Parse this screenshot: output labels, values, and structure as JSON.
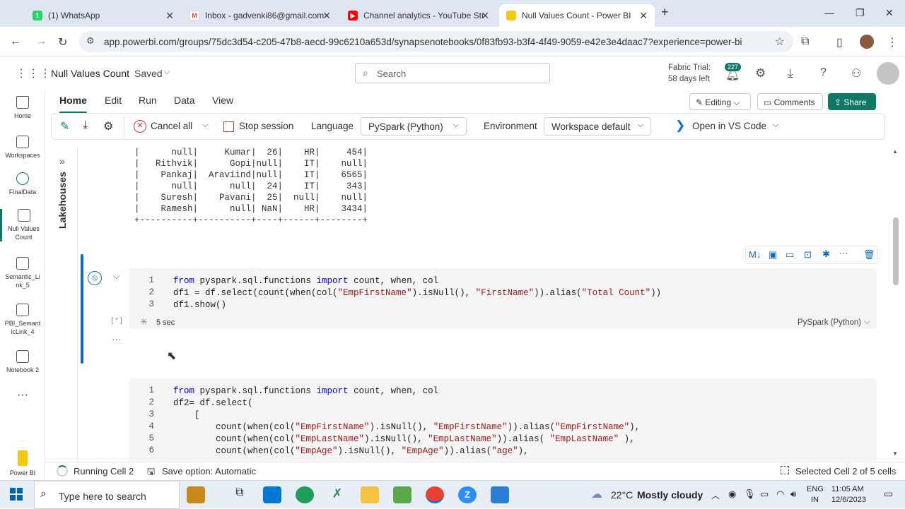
{
  "browser": {
    "tabs": [
      {
        "label": "(1) WhatsApp",
        "icon": "whatsapp-icon",
        "color": "#25d366"
      },
      {
        "label": "Inbox - gadvenki86@gmail.com",
        "icon": "gmail-icon",
        "color": "#ea4335"
      },
      {
        "label": "Channel analytics - YouTube Stu",
        "icon": "youtube-icon",
        "color": "#ff0000"
      },
      {
        "label": "Null Values Count - Power BI",
        "icon": "powerbi-icon",
        "color": "#f2c811"
      }
    ],
    "url": "app.powerbi.com/groups/75dc3d54-c205-47b8-aecd-99c6210a653d/synapsenotebooks/0f83fb93-b3f4-4f49-9059-e42e3e4daac7?experience=power-bi"
  },
  "header": {
    "title": "Null Values Count",
    "saved": "Saved",
    "search_placeholder": "Search",
    "trial_line1": "Fabric Trial:",
    "trial_line2": "58 days left",
    "notif_count": "227"
  },
  "rail": [
    {
      "label": "Home",
      "icon": "home-icon"
    },
    {
      "label": "Workspaces",
      "icon": "workspaces-icon"
    },
    {
      "label": "FinalData",
      "icon": "dataset-icon"
    },
    {
      "label": "Null Values Count",
      "icon": "notebook-icon"
    },
    {
      "label": "Semantic_Link_5",
      "icon": "notebook-icon"
    },
    {
      "label": "PBI_SemanticLink_4",
      "icon": "notebook-icon"
    },
    {
      "label": "Notebook 2",
      "icon": "notebook-icon"
    },
    {
      "label": "Power BI",
      "icon": "powerbi-icon"
    }
  ],
  "ribbon": {
    "tabs": [
      "Home",
      "Edit",
      "Run",
      "Data",
      "View"
    ],
    "editing": "Editing",
    "comments": "Comments",
    "share": "Share",
    "cancel_all": "Cancel all",
    "stop_session": "Stop session",
    "language_label": "Language",
    "language_value": "PySpark (Python)",
    "environment_label": "Environment",
    "environment_value": "Workspace default",
    "open_vscode": "Open in VS Code"
  },
  "notebook": {
    "side_panel": "Lakehouses",
    "output_lines": [
      "|      null|     Kumar|  26|    HR|     454|",
      "|   Rithvik|      Gopi|null|    IT|    null|",
      "|    Pankaj|  Araviind|null|    IT|    6565|",
      "|      null|      null|  24|    IT|     343|",
      "|    Suresh|    Pavani|  25|  null|    null|",
      "|    Ramesh|      null| NaN|    HR|    3434|",
      "+----------+----------+----+------+--------+"
    ],
    "cell1": {
      "lines": [
        {
          "n": "1",
          "parts": [
            {
              "t": "from",
              "c": "kw"
            },
            {
              "t": " pyspark.sql.functions ",
              "c": ""
            },
            {
              "t": "import",
              "c": "kw"
            },
            {
              "t": " count, when, col",
              "c": ""
            }
          ]
        },
        {
          "n": "2",
          "parts": [
            {
              "t": "df1 = df.select(count(when(col(",
              "c": ""
            },
            {
              "t": "\"EmpFirstName\"",
              "c": "st"
            },
            {
              "t": ").isNull(), ",
              "c": ""
            },
            {
              "t": "\"FirstName\"",
              "c": "st"
            },
            {
              "t": ")).alias(",
              "c": ""
            },
            {
              "t": "\"Total Count\"",
              "c": "st"
            },
            {
              "t": "))",
              "c": ""
            }
          ]
        },
        {
          "n": "3",
          "parts": [
            {
              "t": "df1.show()",
              "c": ""
            }
          ]
        }
      ],
      "exec_count": "[*]",
      "duration": "5 sec",
      "language": "PySpark (Python)"
    },
    "cell2": {
      "lines": [
        {
          "n": "1",
          "parts": [
            {
              "t": "from",
              "c": "kw"
            },
            {
              "t": " pyspark.sql.functions ",
              "c": ""
            },
            {
              "t": "import",
              "c": "kw"
            },
            {
              "t": " count, when, col",
              "c": ""
            }
          ]
        },
        {
          "n": "2",
          "parts": [
            {
              "t": "df2= df.select(",
              "c": ""
            }
          ]
        },
        {
          "n": "3",
          "parts": [
            {
              "t": "    [",
              "c": ""
            }
          ]
        },
        {
          "n": "4",
          "parts": [
            {
              "t": "        count(when(col(",
              "c": ""
            },
            {
              "t": "\"EmpFirstName\"",
              "c": "st"
            },
            {
              "t": ").isNull(), ",
              "c": ""
            },
            {
              "t": "\"EmpFirstName\"",
              "c": "st"
            },
            {
              "t": ")).alias(",
              "c": ""
            },
            {
              "t": "\"EmpFirstName\"",
              "c": "st"
            },
            {
              "t": "),",
              "c": ""
            }
          ]
        },
        {
          "n": "5",
          "parts": [
            {
              "t": "        count(when(col(",
              "c": ""
            },
            {
              "t": "\"EmpLastName\"",
              "c": "st"
            },
            {
              "t": ").isNull(), ",
              "c": ""
            },
            {
              "t": "\"EmpLastName\"",
              "c": "st"
            },
            {
              "t": ")).alias( ",
              "c": ""
            },
            {
              "t": "\"EmpLastName\"",
              "c": "st"
            },
            {
              "t": " ),",
              "c": ""
            }
          ]
        },
        {
          "n": "6",
          "parts": [
            {
              "t": "        count(when(col(",
              "c": ""
            },
            {
              "t": "\"EmpAge\"",
              "c": "st"
            },
            {
              "t": ").isNull(), ",
              "c": ""
            },
            {
              "t": "\"EmpAge\"",
              "c": "st"
            },
            {
              "t": ")).alias(",
              "c": ""
            },
            {
              "t": "\"age\"",
              "c": "st"
            },
            {
              "t": "),",
              "c": ""
            }
          ]
        }
      ]
    }
  },
  "status": {
    "running": "Running Cell 2",
    "save_option": "Save option: Automatic",
    "selected": "Selected Cell 2 of 5 cells"
  },
  "taskbar": {
    "search_placeholder": "Type here to search",
    "weather_temp": "22°C",
    "weather_desc": "Mostly cloudy",
    "lang1": "ENG",
    "lang2": "IN",
    "time": "11:05 AM",
    "date": "12/6/2023"
  }
}
